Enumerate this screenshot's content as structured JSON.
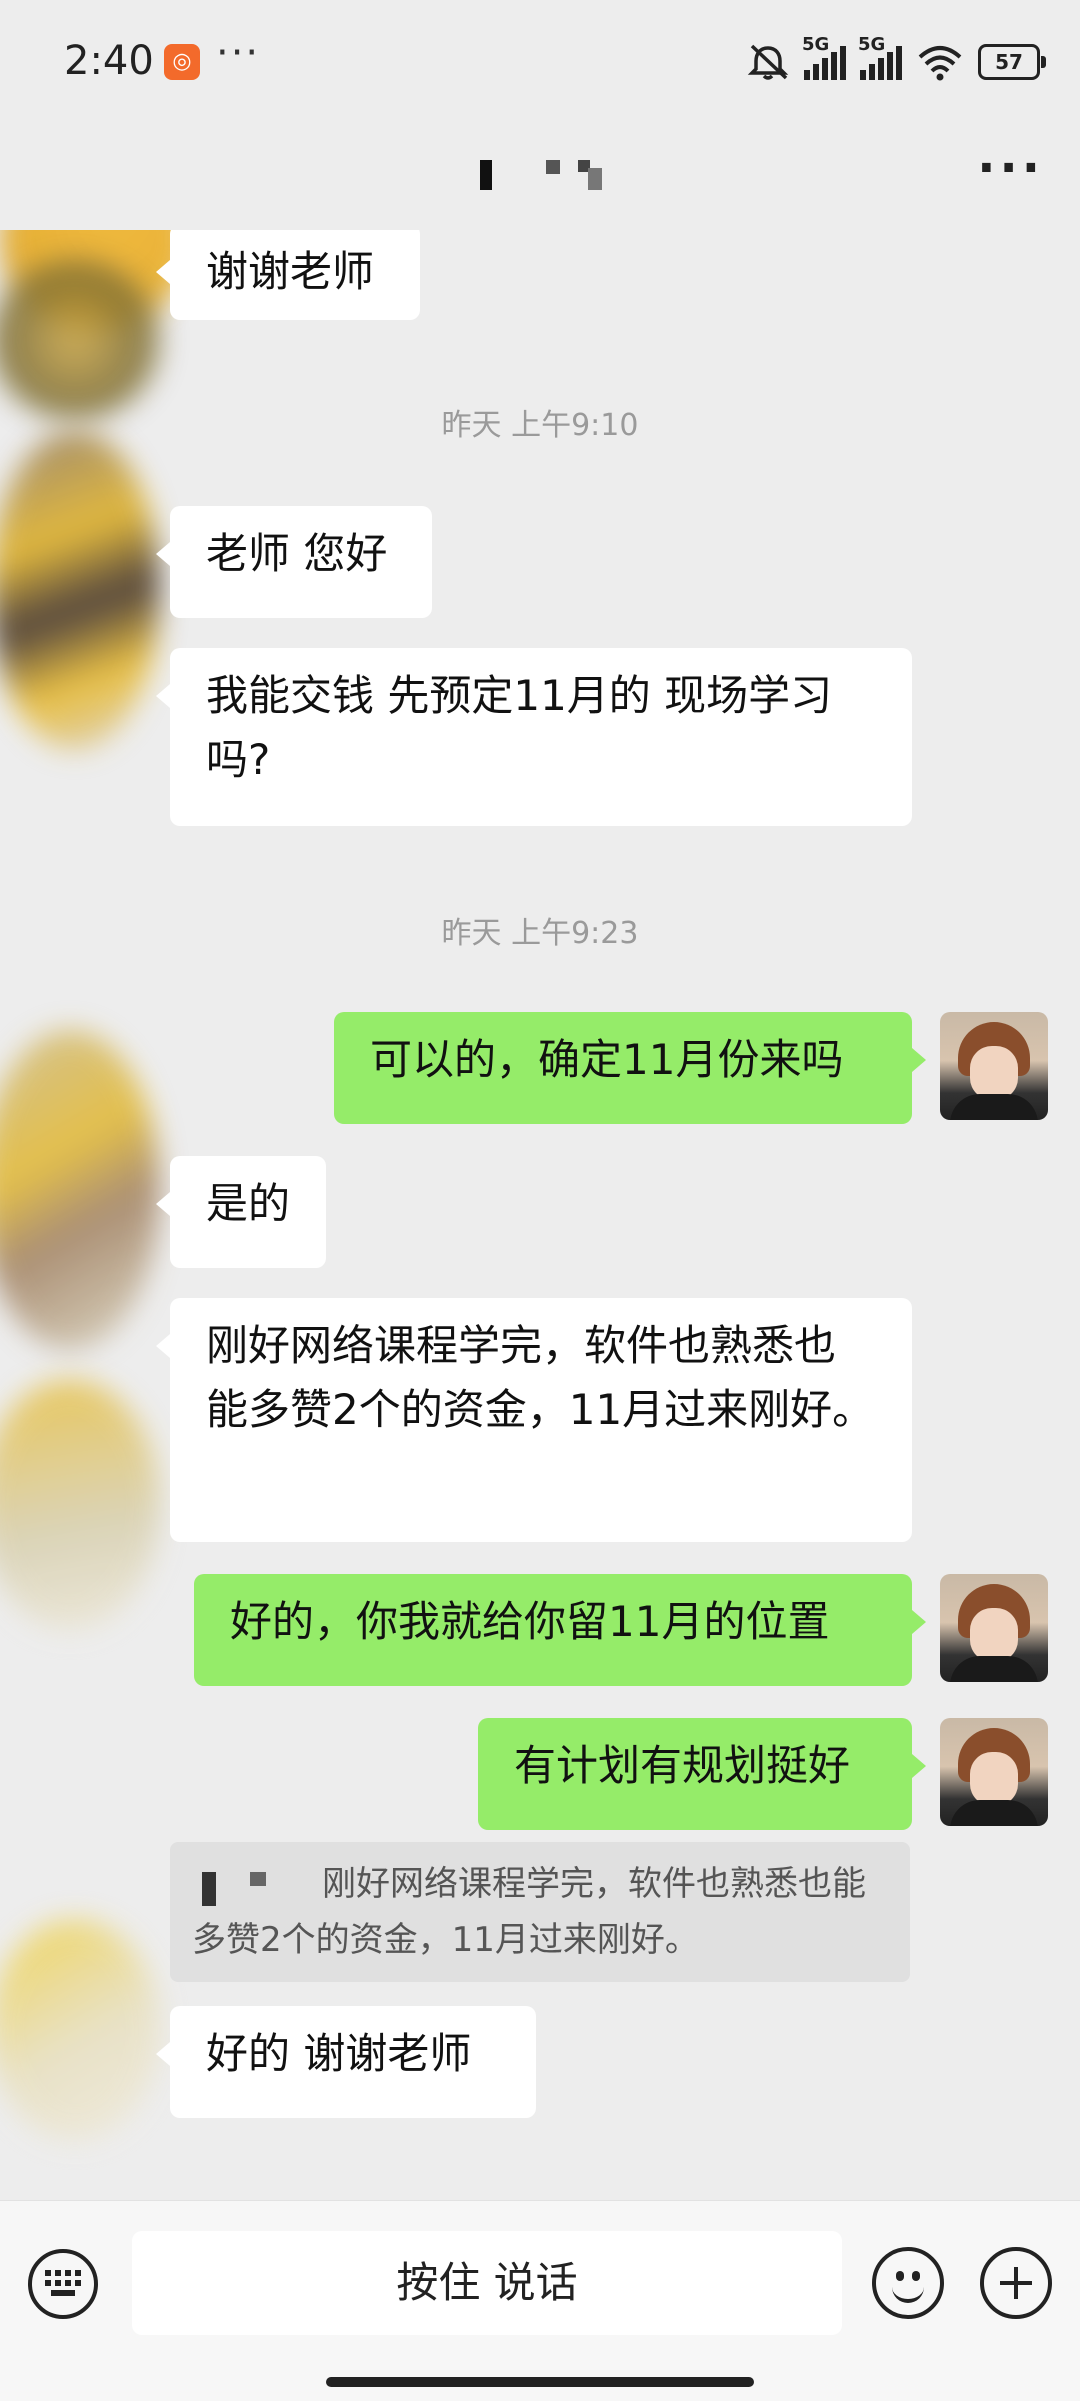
{
  "status_bar": {
    "time": "2:40",
    "dots": "···",
    "network_1": "5G",
    "network_2": "5G",
    "battery": "57"
  },
  "header": {
    "more": "···"
  },
  "messages": [
    {
      "type": "in",
      "text": "谢谢老师"
    },
    {
      "type": "time",
      "text": "昨天 上午9:10"
    },
    {
      "type": "in",
      "text": "老师 您好"
    },
    {
      "type": "in",
      "text": "我能交钱  先预定11月的  现场学习吗?"
    },
    {
      "type": "time",
      "text": "昨天 上午9:23"
    },
    {
      "type": "out",
      "text": "可以的，确定11月份来吗"
    },
    {
      "type": "in",
      "text": "是的"
    },
    {
      "type": "in",
      "text": "刚好网络课程学完，软件也熟悉也能多赞2个的资金，11月过来刚好。"
    },
    {
      "type": "out",
      "text": "好的，你我就给你留11月的位置"
    },
    {
      "type": "out",
      "text": "有计划有规划挺好"
    },
    {
      "type": "quote",
      "text": "刚好网络课程学完，软件也熟悉也能多赞2个的资金，11月过来刚好。"
    },
    {
      "type": "in",
      "text": "好的  谢谢老师"
    }
  ],
  "input_bar": {
    "hold_to_talk": "按住 说话"
  },
  "colors": {
    "incoming_bubble": "#ffffff",
    "outgoing_bubble": "#95ec69",
    "background": "#ededed"
  }
}
